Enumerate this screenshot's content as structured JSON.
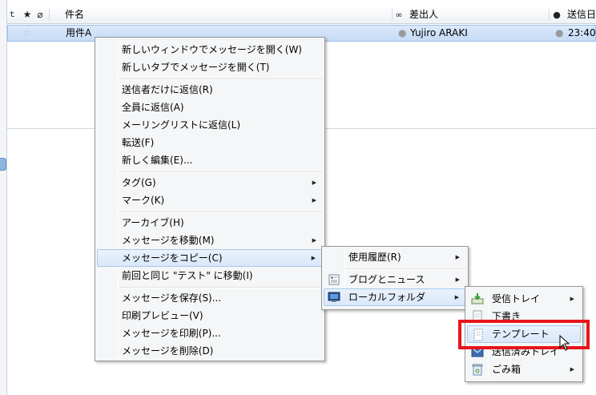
{
  "header": {
    "col_subject": "件名",
    "col_sender": "差出人",
    "col_date": "送信日"
  },
  "row": {
    "subject": "用件A",
    "sender": "Yujiro ARAKI",
    "date": "23:40"
  },
  "context_menu": {
    "items": [
      {
        "label": "新しいウィンドウでメッセージを開く(W)"
      },
      {
        "label": "新しいタブでメッセージを開く(T)"
      },
      {
        "label": "送信者だけに返信(R)"
      },
      {
        "label": "全員に返信(A)"
      },
      {
        "label": "メーリングリストに返信(L)"
      },
      {
        "label": "転送(F)"
      },
      {
        "label": "新しく編集(E)..."
      },
      {
        "label": "タグ(G)"
      },
      {
        "label": "マーク(K)"
      },
      {
        "label": "アーカイブ(H)"
      },
      {
        "label": "メッセージを移動(M)"
      },
      {
        "label": "メッセージをコピー(C)"
      },
      {
        "label": "前回と同じ \"テスト\" に移動(I)"
      },
      {
        "label": "メッセージを保存(S)..."
      },
      {
        "label": "印刷プレビュー(V)"
      },
      {
        "label": "メッセージを印刷(P)..."
      },
      {
        "label": "メッセージを削除(D)"
      }
    ]
  },
  "copy_submenu": {
    "items": [
      {
        "label": "使用履歴(R)"
      },
      {
        "label": "ブログとニュース"
      },
      {
        "label": "ローカルフォルダ"
      }
    ]
  },
  "folder_submenu": {
    "items": [
      {
        "label": "受信トレイ"
      },
      {
        "label": "下書き"
      },
      {
        "label": "テンプレート"
      },
      {
        "label": "送信済みトレイ"
      },
      {
        "label": "ごみ箱"
      }
    ]
  },
  "colors": {
    "highlight_border": "#e8141b",
    "selection": "#c5dbf6"
  }
}
